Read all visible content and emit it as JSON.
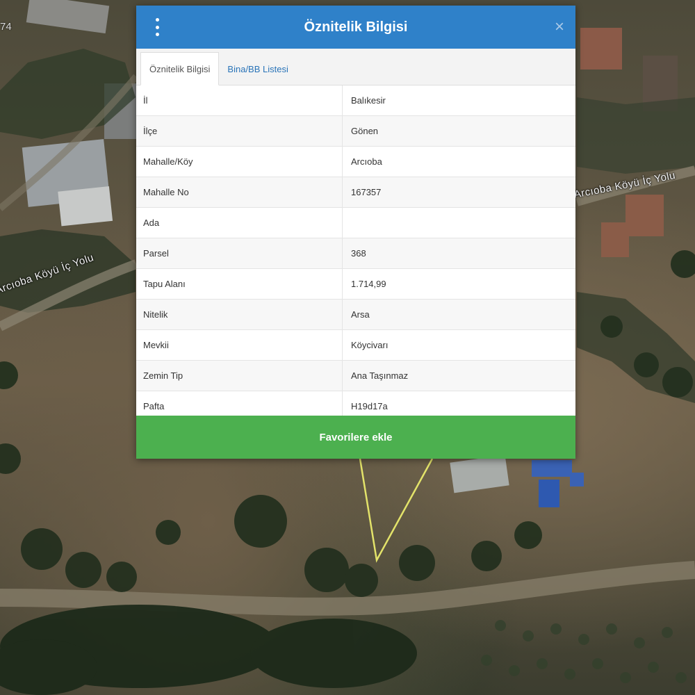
{
  "map": {
    "road_label_left": "Arcıoba Köyü İç Yolu",
    "road_label_right": "Arcıoba Köyü İç Yolu",
    "corner_label": "74"
  },
  "dialog": {
    "title": "Öznitelik Bilgisi",
    "close_symbol": "×",
    "tabs": [
      {
        "label": "Öznitelik Bilgisi",
        "active": true
      },
      {
        "label": "Bina/BB Listesi",
        "active": false
      }
    ],
    "rows": [
      {
        "key": "İl",
        "value": "Balıkesir"
      },
      {
        "key": "İlçe",
        "value": "Gönen"
      },
      {
        "key": "Mahalle/Köy",
        "value": "Arcıoba"
      },
      {
        "key": "Mahalle No",
        "value": "167357"
      },
      {
        "key": "Ada",
        "value": ""
      },
      {
        "key": "Parsel",
        "value": "368"
      },
      {
        "key": "Tapu Alanı",
        "value": "1.714,99"
      },
      {
        "key": "Nitelik",
        "value": "Arsa"
      },
      {
        "key": "Mevkii",
        "value": "Köycivarı"
      },
      {
        "key": "Zemin Tip",
        "value": "Ana Taşınmaz"
      },
      {
        "key": "Pafta",
        "value": "H19d17a"
      }
    ],
    "favorite_button": "Favorilere ekle"
  },
  "icons": {
    "menu": "kebab-menu-icon",
    "close": "close-icon"
  },
  "colors": {
    "header": "#2f81c9",
    "favorite_button": "#4cb04f",
    "tab_link": "#2a74b8"
  }
}
